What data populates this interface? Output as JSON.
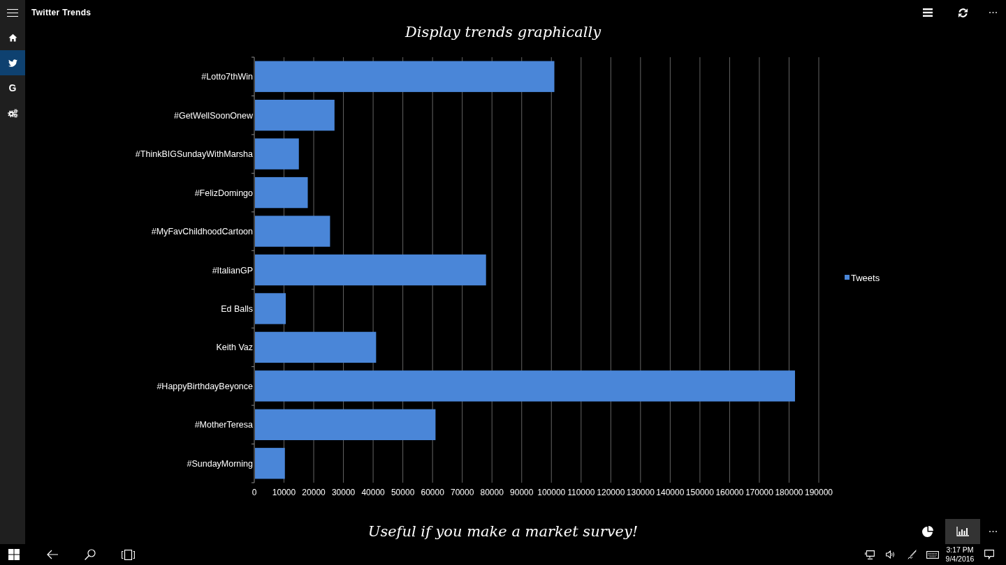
{
  "window": {
    "title": "Twitter Trends"
  },
  "sidebar": {
    "items": [
      {
        "kind": "home",
        "selected": false
      },
      {
        "kind": "twitter",
        "selected": true
      },
      {
        "kind": "text",
        "label": "G",
        "selected": false
      },
      {
        "kind": "settings",
        "selected": false
      }
    ]
  },
  "heading": "Display trends graphically",
  "chart": {
    "chart_data": {
      "type": "bar",
      "orientation": "horizontal",
      "categories": [
        "#Lotto7thWin",
        "#GetWellSoonOnew",
        "#ThinkBIGSundayWithMarsha",
        "#FelizDomingo",
        "#MyFavChildhoodCartoon",
        "#ItalianGP",
        "Ed Balls",
        "Keith Vaz",
        "#HappyBirthdayBeyonce",
        "#MotherTeresa",
        "#SundayMorning"
      ],
      "series": [
        {
          "name": "Tweets",
          "color": "#4a86d8",
          "values": [
            101000,
            27000,
            15000,
            18000,
            25500,
            78000,
            10600,
            41000,
            182000,
            61000,
            10300
          ]
        }
      ],
      "xlim": [
        0,
        190000
      ],
      "xticks": [
        0,
        10000,
        20000,
        30000,
        40000,
        50000,
        60000,
        70000,
        80000,
        90000,
        100000,
        110000,
        120000,
        130000,
        140000,
        150000,
        160000,
        170000,
        180000,
        190000
      ],
      "grid": true,
      "legend": "right"
    }
  },
  "caption": "Useful if you make a market survey!",
  "app_bar": {
    "items": [
      {
        "kind": "pie",
        "selected": false
      },
      {
        "kind": "bar",
        "selected": true
      }
    ]
  },
  "taskbar": {
    "time": "3:17 PM",
    "date": "9/4/2016"
  }
}
